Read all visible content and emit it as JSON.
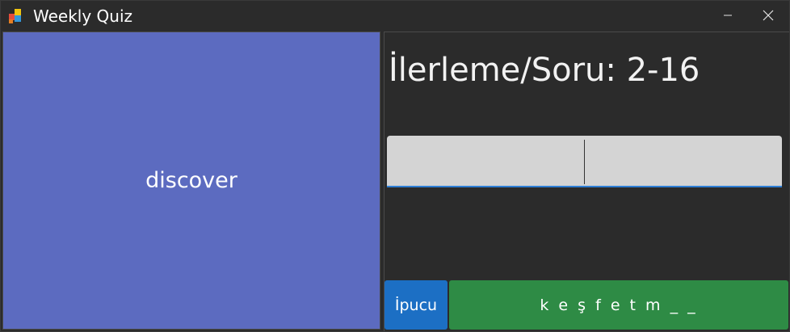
{
  "window": {
    "title": "Weekly Quiz",
    "icon": "app-grid-icon",
    "controls": {
      "minimize_icon": "minimize-icon",
      "close_icon": "close-icon"
    }
  },
  "word_card": {
    "word": "discover",
    "background": "#5c6bc0"
  },
  "quiz": {
    "progress_label": "İlerleme/Soru: 2-16",
    "answer_input": {
      "value": "",
      "placeholder": ""
    },
    "hint_button_label": "İpucu",
    "answer_pattern": "k e ş f e t m _ _"
  },
  "colors": {
    "background": "#2b2b2b",
    "hint_button": "#1c6fc4",
    "answer_pattern": "#2e8b45",
    "input_underline": "#2e7ed6"
  }
}
